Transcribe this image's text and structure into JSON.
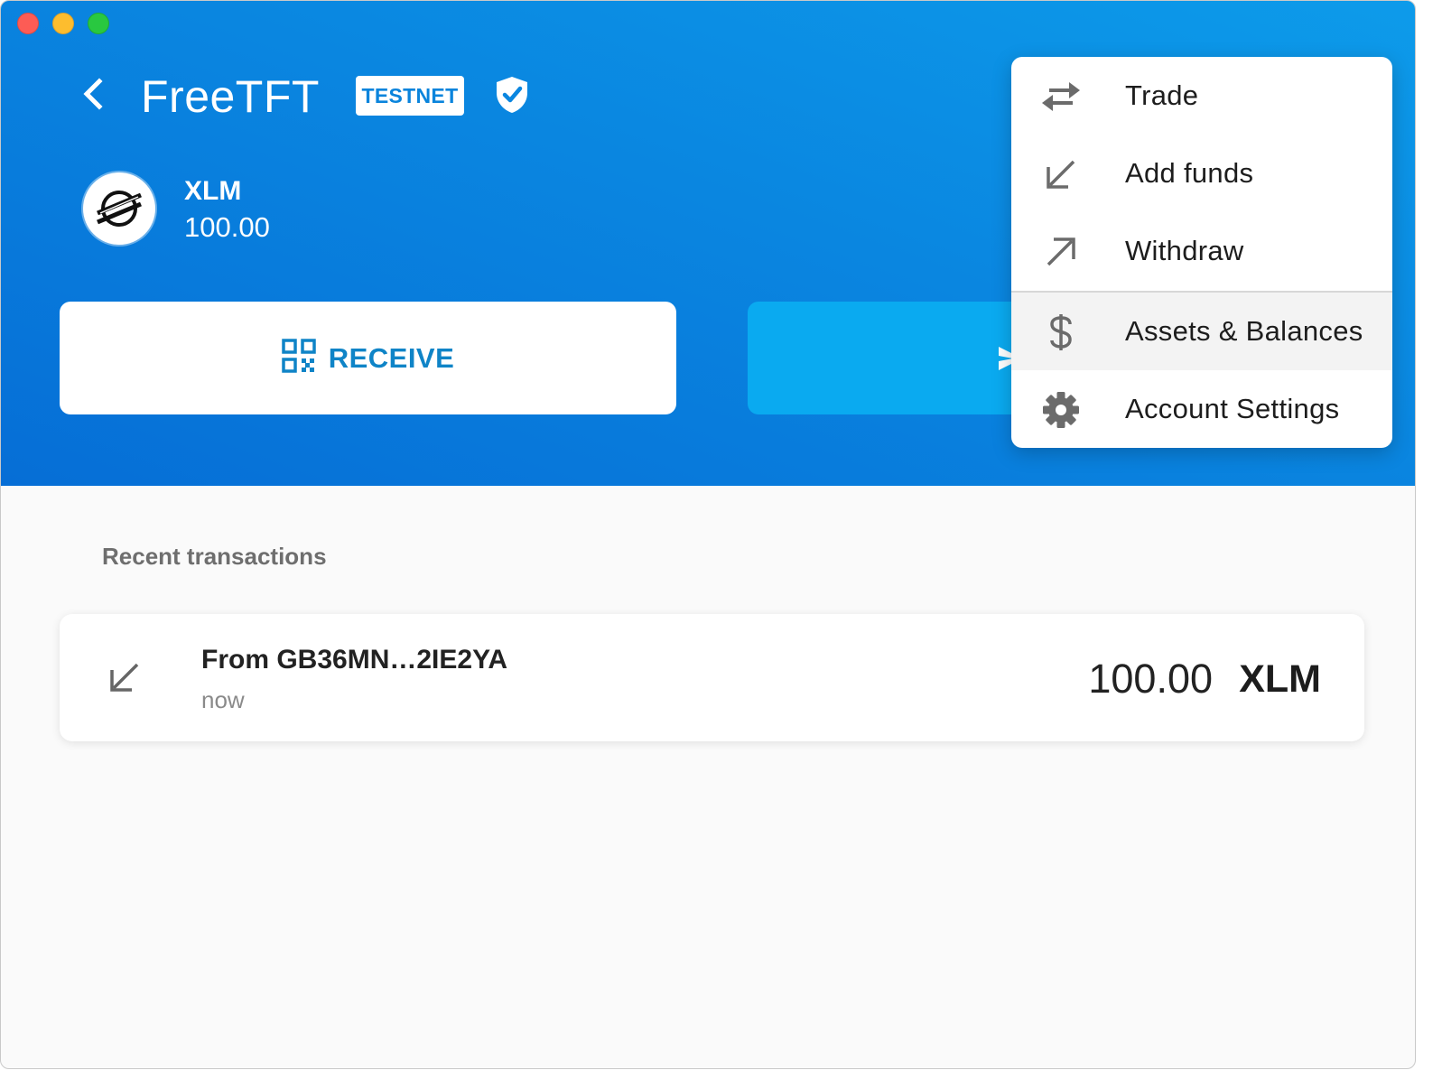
{
  "window": {
    "controls": [
      "close",
      "minimize",
      "zoom"
    ]
  },
  "header": {
    "account_name": "FreeTFT",
    "network_badge": "TESTNET",
    "asset_code": "XLM",
    "asset_balance": "100.00",
    "icons": {
      "back": "chevron-left-icon",
      "verified": "shield-check-icon",
      "asset_logo": "stellar-logo"
    },
    "gradient": [
      "#0d9bea",
      "#066ed6"
    ]
  },
  "actions": {
    "receive_label": "RECEIVE",
    "receive_icon": "qr-code-icon",
    "send_icon": "send-icon",
    "receive_color": "#0f84c7",
    "send_bg": "#0aaaf0"
  },
  "transactions": {
    "title": "Recent transactions",
    "items": [
      {
        "direction_icon": "arrow-down-left-icon",
        "from": "From GB36MN…2IE2YA",
        "time": "now",
        "amount": "100.00",
        "code": "XLM"
      }
    ]
  },
  "menu": {
    "items": [
      {
        "label": "Trade",
        "icon": "swap-arrows-icon"
      },
      {
        "label": "Add funds",
        "icon": "arrow-down-left-icon"
      },
      {
        "label": "Withdraw",
        "icon": "arrow-up-right-icon"
      },
      {
        "label": "Assets & Balances",
        "icon": "dollar-icon",
        "highlighted": true
      },
      {
        "label": "Account Settings",
        "icon": "gear-icon"
      }
    ]
  }
}
